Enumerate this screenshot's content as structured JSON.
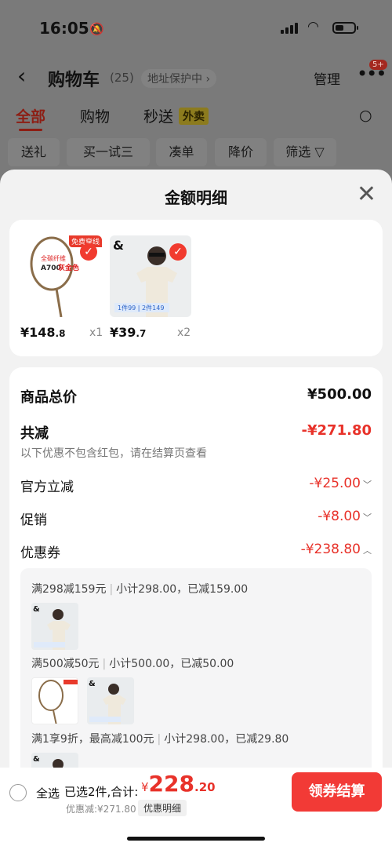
{
  "status_bar": {
    "time": "16:05"
  },
  "nav": {
    "title": "购物车",
    "count": "(25)",
    "address": "地址保护中",
    "manage": "管理",
    "badge": "5+"
  },
  "tabs": [
    {
      "label": "全部"
    },
    {
      "label": "购物"
    },
    {
      "label": "秒送"
    }
  ],
  "tab_tag": "外卖",
  "chips": [
    "送礼",
    "买一试三",
    "凑单",
    "降价",
    "筛选"
  ],
  "sheet": {
    "title": "金额明细"
  },
  "products": [
    {
      "price_int": "¥148",
      "price_dec": ".8",
      "qty": "x1",
      "promo": "免费穿线"
    },
    {
      "price_int": "¥39",
      "price_dec": ".7",
      "qty": "x2"
    }
  ],
  "details": {
    "goods_total_label": "商品总价",
    "goods_total_value": "¥500.00",
    "reduce_label": "共减",
    "reduce_value": "-¥271.80",
    "reduce_note": "以下优惠不包含红包，请在结算页查看",
    "official_label": "官方立减",
    "official_value": "-¥25.00",
    "promo_label": "促销",
    "promo_value": "-¥8.00",
    "coupon_label": "优惠券",
    "coupon_value": "-¥238.80"
  },
  "coupons": [
    {
      "rule": "满298减159元",
      "detail": "小计298.00，已减159.00"
    },
    {
      "rule": "满500减50元",
      "detail": "小计500.00，已减50.00"
    },
    {
      "rule": "满1享9折，最高减100元",
      "detail": "小计298.00，已减29.80"
    }
  ],
  "bottom": {
    "select_all": "全选",
    "summary": "已选2件,合计:",
    "total_currency": "¥",
    "total_int": "228",
    "total_dec": ".20",
    "discount": "优惠减:¥271.80",
    "detail_link": "优惠明细",
    "checkout": "领券结算"
  },
  "colors": {
    "accent_red": "#e8322a",
    "checkout_bg": "#f23a36"
  }
}
